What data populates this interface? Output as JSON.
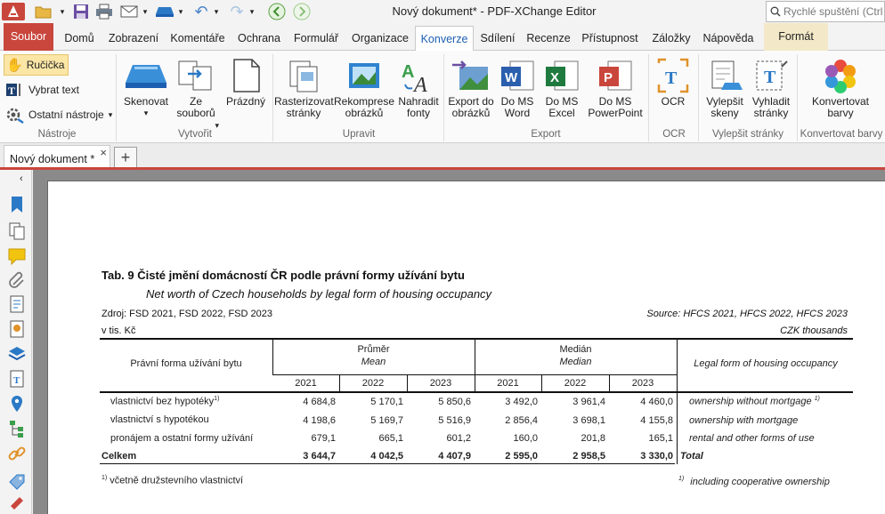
{
  "window": {
    "title": "Nový dokument* - PDF-XChange Editor"
  },
  "quick_search": {
    "placeholder": "Rychlé spuštění (Ctrl+."
  },
  "menu_tabs": [
    {
      "label": "Soubor"
    },
    {
      "label": "Domů"
    },
    {
      "label": "Zobrazení"
    },
    {
      "label": "Komentáře"
    },
    {
      "label": "Ochrana"
    },
    {
      "label": "Formulář"
    },
    {
      "label": "Organizace"
    },
    {
      "label": "Konverze"
    },
    {
      "label": "Sdílení"
    },
    {
      "label": "Recenze"
    },
    {
      "label": "Přístupnost"
    },
    {
      "label": "Záložky"
    },
    {
      "label": "Nápověda"
    },
    {
      "label": "Formát"
    }
  ],
  "ribbon": {
    "tools": {
      "hand": "Ručička",
      "select_text": "Vybrat text",
      "other_tools": "Ostatní nástroje",
      "group": "Nástroje"
    },
    "create": {
      "scan": "Skenovat",
      "from_files_1": "Ze",
      "from_files_2": "souborů",
      "blank": "Prázdný",
      "group": "Vytvořit"
    },
    "edit": {
      "rasterize_1": "Rasterizovat",
      "rasterize_2": "stránky",
      "recompress_1": "Rekomprese",
      "recompress_2": "obrázků",
      "replace_fonts_1": "Nahradit",
      "replace_fonts_2": "fonty",
      "group": "Upravit"
    },
    "export": {
      "images_1": "Export do",
      "images_2": "obrázků",
      "word_1": "Do MS",
      "word_2": "Word",
      "excel_1": "Do MS",
      "excel_2": "Excel",
      "ppt_1": "Do MS",
      "ppt_2": "PowerPoint",
      "group": "Export"
    },
    "ocr": {
      "ocr": "OCR",
      "group": "OCR"
    },
    "enhance": {
      "improve_1": "Vylepšit",
      "improve_2": "skeny",
      "smooth_1": "Vyhladit",
      "smooth_2": "stránky",
      "group": "Vylepšit stránky"
    },
    "colors": {
      "convert_1": "Konvertovat",
      "convert_2": "barvy",
      "group": "Konvertovat barvy"
    }
  },
  "doc_tab": {
    "label": "Nový dokument *",
    "close": "×",
    "new": "+"
  },
  "page": {
    "title": "Tab. 9 Čisté jmění domácností ČR podle právní formy užívání bytu",
    "subtitle": "Net worth of Czech households by legal form of housing occupancy",
    "source_cz": "Zdroj: FSD 2021, FSD 2022, FSD 2023",
    "source_en": "Source: HFCS 2021, HFCS 2022, HFCS 2023",
    "unit_cz": "v tis. Kč",
    "unit_en": "CZK thousands",
    "table": {
      "col_label_cz": "Právní forma užívání bytu",
      "col_label_en": "Legal form of housing occupancy",
      "mean_cz": "Průměr",
      "mean_en": "Mean",
      "median_cz": "Medián",
      "median_en": "Median",
      "years": [
        "2021",
        "2022",
        "2023",
        "2021",
        "2022",
        "2023"
      ],
      "rows": [
        {
          "cz": "vlastnictví bez hypotéky",
          "cz_sup": "1)",
          "en": "ownership without mortgage",
          "en_sup": "1)",
          "values": [
            "4 684,8",
            "5 170,1",
            "5 850,6",
            "3 492,0",
            "3 961,4",
            "4 460,0"
          ]
        },
        {
          "cz": "vlastnictví s hypotékou",
          "cz_sup": "",
          "en": "ownership with mortgage",
          "en_sup": "",
          "values": [
            "4 198,6",
            "5 169,7",
            "5 516,9",
            "2 856,4",
            "3 698,1",
            "4 155,8"
          ]
        },
        {
          "cz": "pronájem a ostatní formy užívání",
          "cz_sup": "",
          "en": "rental and other forms of use",
          "en_sup": "",
          "values": [
            "679,1",
            "665,1",
            "601,2",
            "160,0",
            "201,8",
            "165,1"
          ]
        },
        {
          "cz": "Celkem",
          "cz_sup": "",
          "en": "Total",
          "en_sup": "",
          "values": [
            "3 644,7",
            "4 042,5",
            "4 407,9",
            "2 595,0",
            "2 958,5",
            "3 330,0"
          ]
        }
      ]
    },
    "footnote_cz_sup": "1)",
    "footnote_cz": "včetně družstevního vlastnictví",
    "footnote_en_sup": "1)",
    "footnote_en": "including cooperative ownership"
  },
  "colors": {
    "accent_red": "#c9463d",
    "konverze_blue": "#1c5fb0"
  }
}
